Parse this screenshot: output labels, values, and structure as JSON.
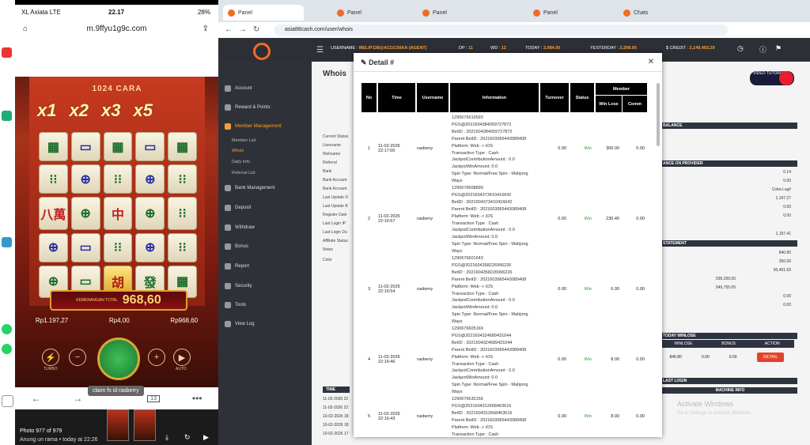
{
  "phone": {
    "carrier": "XL Axiata  LTE",
    "time": "22.17",
    "battery": "28%",
    "url": "m.9ffyu1g9c.com",
    "game_title": "1024 CARA",
    "multipliers": [
      "x1",
      "x2",
      "x3",
      "x5"
    ],
    "tiles": [
      "",
      "",
      "",
      "",
      "",
      "",
      "",
      "",
      "",
      "",
      "八萬",
      "",
      "中",
      "",
      "",
      "",
      "",
      "",
      "",
      "",
      "",
      "",
      "胡",
      "發",
      ""
    ],
    "win_label": "KEMENANGAN TOTAL",
    "win_value": "968,60",
    "balance": "Rp1.197,27",
    "bet": "Rp4,00",
    "win": "Rp968,60",
    "turbo": "TURBO",
    "auto": "AUTO",
    "tooltip": "claim fs id rasberry",
    "tab_count": "13",
    "photo_count": "Photo 977 of 979",
    "photo_meta": "Anung un rama • today at 22:26"
  },
  "browser": {
    "tabs": [
      "Panel",
      "Panel",
      "Panel",
      "Panel",
      "Chats"
    ],
    "url": "asia88cash.com/user/whois",
    "stats": [
      {
        "label": "USERNAME :",
        "value": "MELIP138@ACGC00AA (AGENT)"
      },
      {
        "label": "DP :",
        "value": "11"
      },
      {
        "label": "WD :",
        "value": "12"
      },
      {
        "label": "TODAY :",
        "value": "2,084.00"
      },
      {
        "label": "YESTERDAY :",
        "value": "2,208.00"
      },
      {
        "label": "$ CREDIT :",
        "value": "2,149,493.29"
      }
    ]
  },
  "sidebar": {
    "items": [
      {
        "label": "Account"
      },
      {
        "label": "Reward & Points"
      },
      {
        "label": "Member Management"
      },
      {
        "label": "Bank Management"
      },
      {
        "label": "Deposit"
      },
      {
        "label": "Withdraw"
      },
      {
        "label": "Bonus"
      },
      {
        "label": "Report"
      },
      {
        "label": "Security"
      },
      {
        "label": "Tools"
      },
      {
        "label": "View Log"
      }
    ],
    "subs": [
      "Member List",
      "Whois",
      "Daily Info",
      "Referral List"
    ]
  },
  "main": {
    "title": "Whois",
    "labels": [
      "Current Status",
      "Username",
      "Nickname",
      "Referral",
      "Bank",
      "Bank Account",
      "Bank Account",
      "Last Update D",
      "Last Update B",
      "Register Date",
      "Last Login IP",
      "Last Login Da",
      "Affiliate Status",
      "Notes",
      "Color"
    ],
    "balance_header": "BALANCE",
    "provider_header": "ANCE ON PROVIDER",
    "provider_vals": [
      "0.14",
      "0.00",
      "Coba Lagi!",
      "1,197.27",
      "0.00",
      "0.00",
      "1,197.41"
    ],
    "statement_header": "STATEMENT",
    "statement_vals": [
      "840.80",
      "350.00",
      "50,451.60",
      "596,206.00",
      "545,755.00",
      "0.00",
      "0.00"
    ],
    "today_header": "TODAY WINLOSE",
    "today_cols": [
      "WINLOSE",
      "BONUS",
      "ACTION"
    ],
    "today_vals": [
      "840.80",
      "0.00",
      "0.00"
    ],
    "detail_btn": "DETAIL",
    "last_login": "LAST LOGIN",
    "machine_info": "MACHINE INFO",
    "time_header": "TIME",
    "time_rows": [
      "11-02-2026 22",
      "11-02-2026 22",
      "10-02-2026 18",
      "10-02-2026 18",
      "10-02-2026 17"
    ],
    "video": "VIDEO TUTORIALS",
    "watermark": "Activate Windows",
    "watermark2": "Go to Settings to activate Windows."
  },
  "modal": {
    "title": "Detail #",
    "headers": [
      "No",
      "Time",
      "Username",
      "Information",
      "Turnover",
      "Status",
      "Member",
      "Win Lose",
      "Comm"
    ],
    "rows": [
      {
        "no": "1",
        "time": "11-02-2026 22:17:00",
        "username": "rasberry",
        "info": [
          "1290676610593",
          "PGS@2021604384059727872",
          "BetID : 2021604384059727872",
          "Parent BetID : 2021603965443089408",
          "Platform: Web -> iOS",
          "Transaction Type : Cash",
          "JackpotContributionAmount : 0.0",
          "JackpotWinAmount: 0.0",
          "Spin Type: Normal/Free Spin - Mahjong",
          "Ways"
        ],
        "turnover": "0.00",
        "status": "Win",
        "winlose": "300.00",
        "comm": "0.00"
      },
      {
        "no": "2",
        "time": "11-02-2026 22:16:57",
        "username": "rasberry",
        "info": [
          "1290676608890",
          "PGS@2021604373410416642",
          "BetID : 2021604373410416642",
          "Parent BetID : 2021603965443089408",
          "Platform: Web -> iOS",
          "Transaction Type : Cash",
          "JackpotContributionAmount : 0.0",
          "JackpotWinAmount: 0.0",
          "Spin Type: Normal/Free Spin - Mahjong",
          "Ways"
        ],
        "turnover": "0.00",
        "status": "Win",
        "winlose": "230.40",
        "comm": "0.00"
      },
      {
        "no": "3",
        "time": "11-02-2026 22:16:54",
        "username": "rasberry",
        "info": [
          "1290676601643",
          "PGS@2021604358226996226",
          "BetID : 2021604358226996226",
          "Parent BetID : 2021603965443089408",
          "Platform: Web -> iOS",
          "Transaction Type : Cash",
          "JackpotContributionAmount : 0.0",
          "JackpotWinAmount: 0.0",
          "Spin Type: Normal/Free Spin - Mahjong",
          "Ways"
        ],
        "turnover": "0.00",
        "status": "Win",
        "winlose": "6.00",
        "comm": "0.00"
      },
      {
        "no": "4",
        "time": "11-02-2026 22:16:46",
        "username": "rasberry",
        "info": [
          "1290676605169",
          "PGS@2021604324689431044",
          "BetID : 2021604324689431044",
          "Parent BetID : 2021603965443089408",
          "Platform: Web -> iOS",
          "Transaction Type : Cash",
          "JackpotContributionAmount : 0.0",
          "JackpotWinAmount: 0.0",
          "Spin Type: Normal/Free Spin - Mahjong",
          "Ways"
        ],
        "turnover": "0.00",
        "status": "Win",
        "winlose": "8.00",
        "comm": "0.00"
      },
      {
        "no": "5",
        "time": "11-02-2026 22:16:43",
        "username": "rasberry",
        "info": [
          "1290676635156",
          "PGS@2021604312668463616",
          "BetID : 2021604312668463616",
          "Parent BetID : 2021603965443089408",
          "Platform: Web -> iOS",
          "Transaction Type : Cash"
        ],
        "turnover": "0.00",
        "status": "Win",
        "winlose": "8.00",
        "comm": "0.00"
      }
    ]
  }
}
